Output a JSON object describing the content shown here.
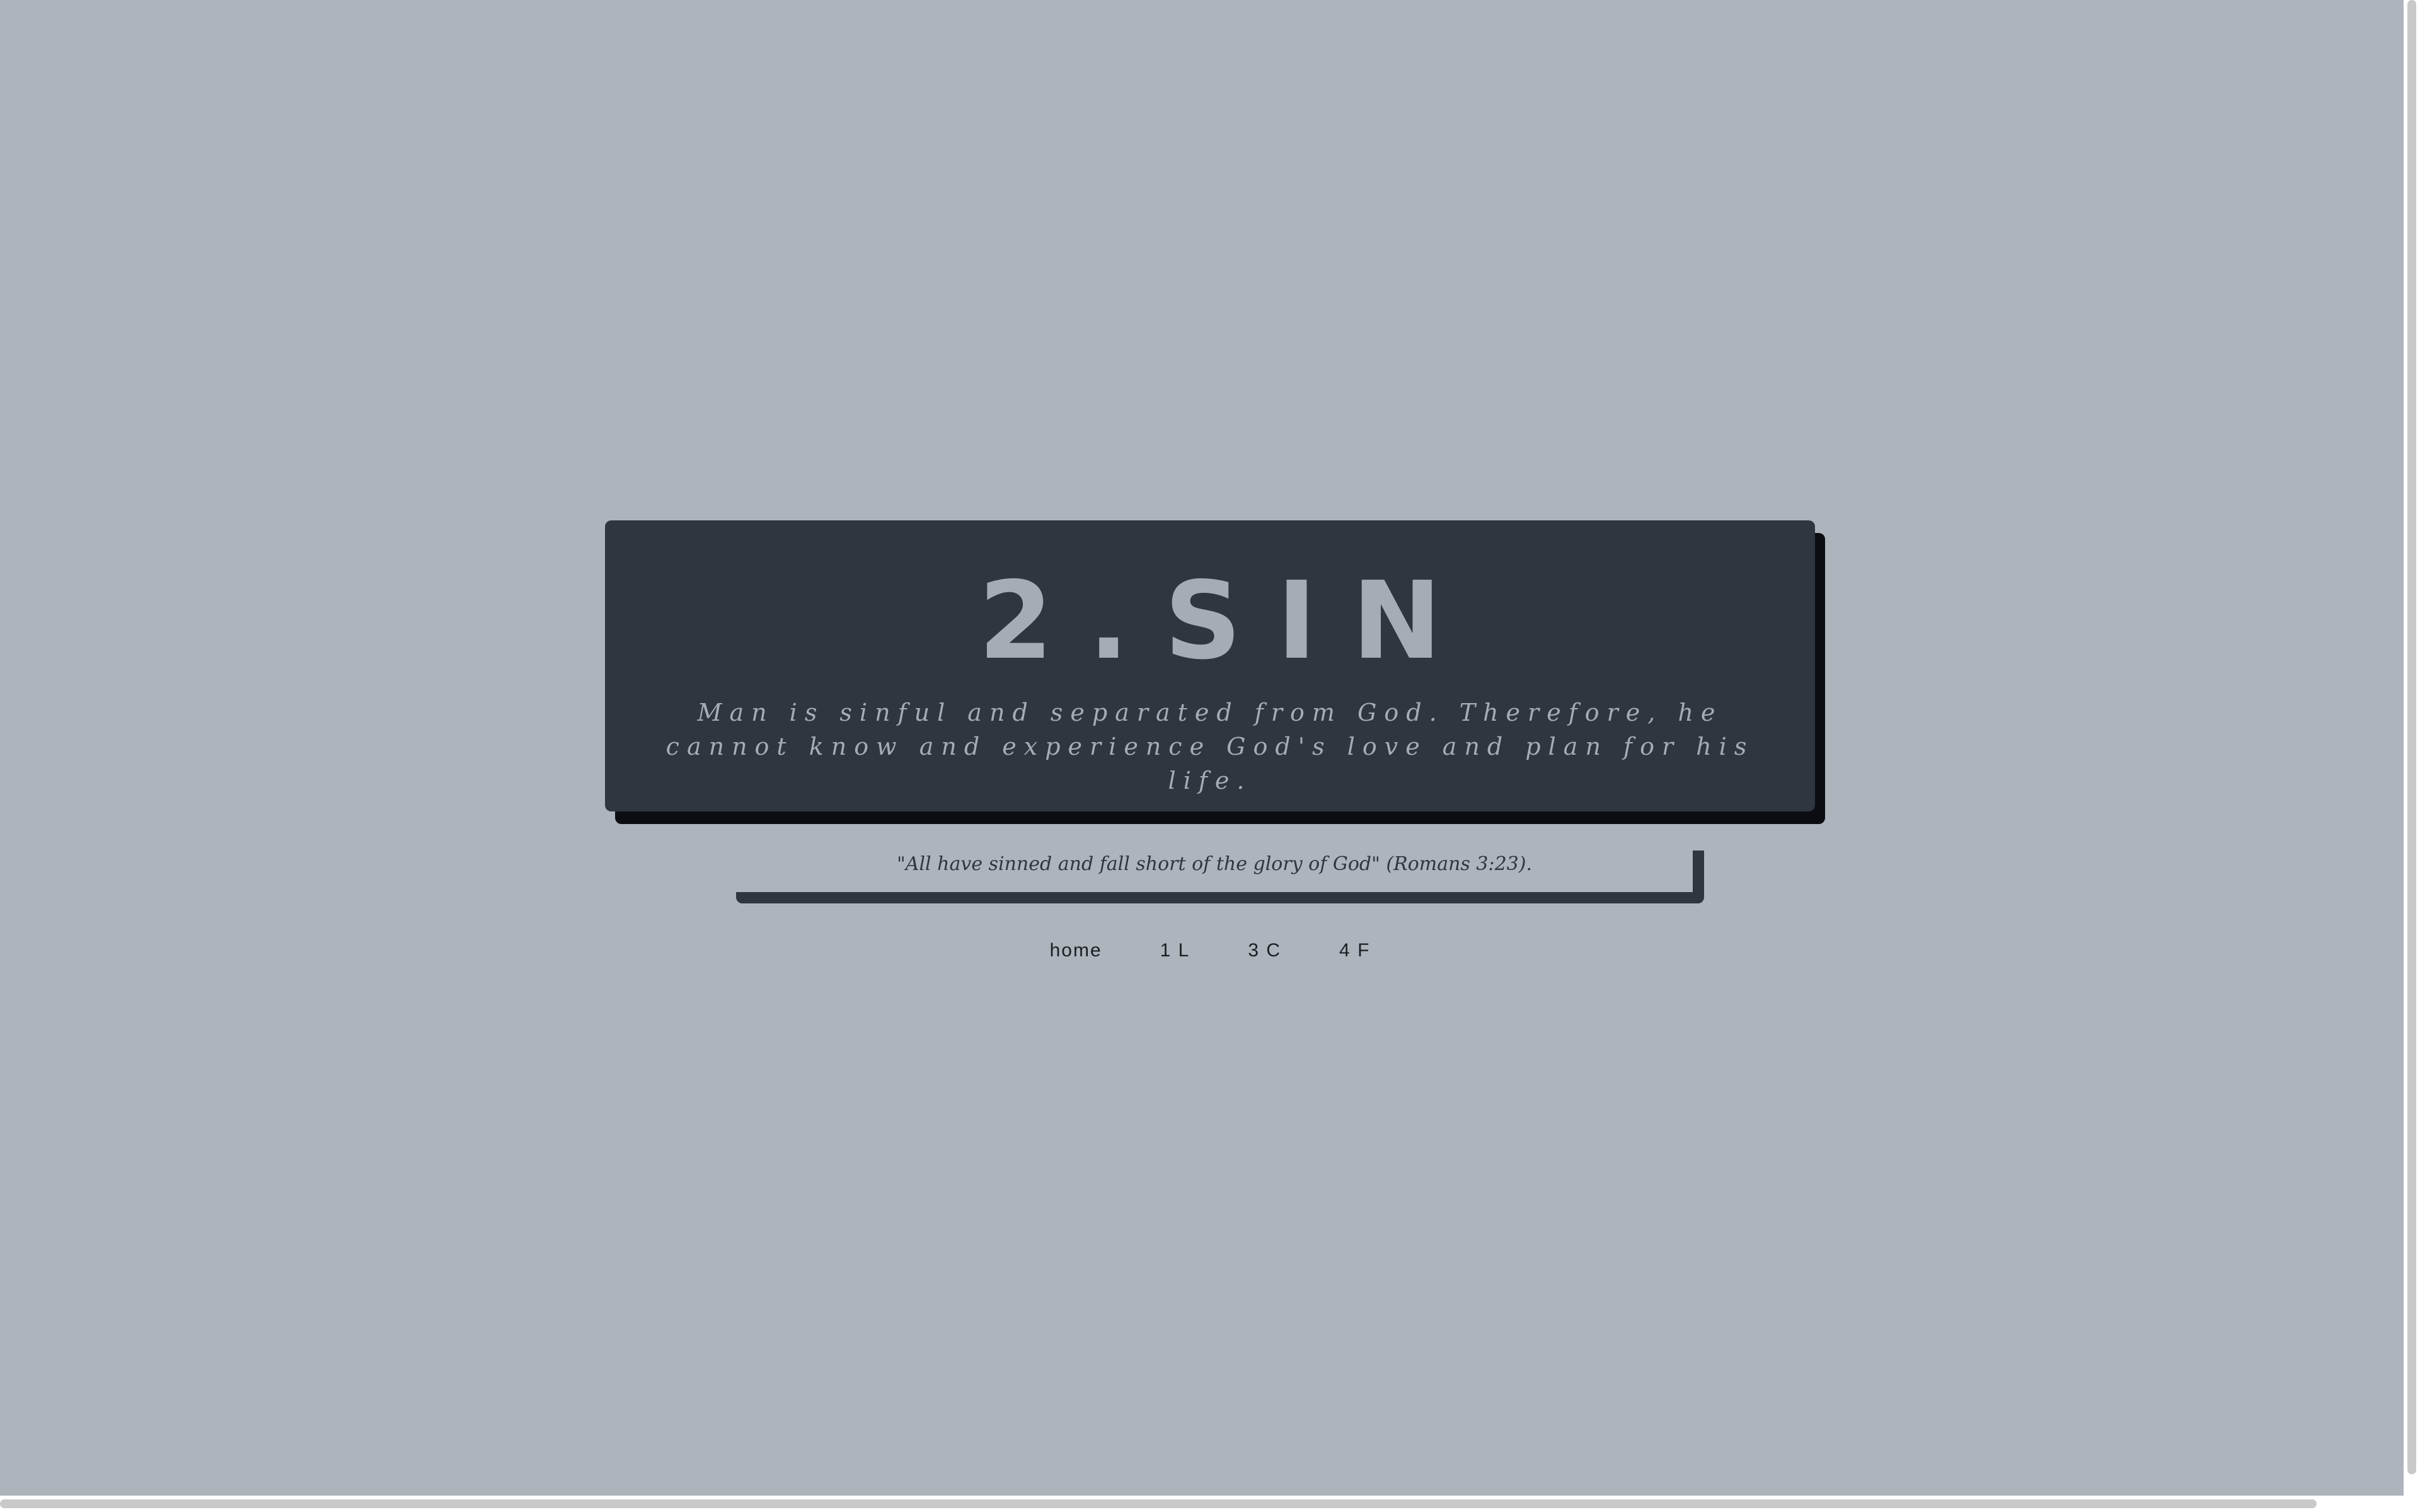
{
  "card": {
    "title": "2.SIN",
    "text": "Man is sinful and separated from God. Therefore, he cannot know and experience God's love and plan for his life."
  },
  "verse": {
    "text": "\"All have sinned and fall short of the glory of God\" (Romans 3:23)."
  },
  "nav": {
    "items": [
      {
        "label": "home"
      },
      {
        "label": "1 L"
      },
      {
        "label": "3 C"
      },
      {
        "label": "4 F"
      }
    ]
  },
  "colors": {
    "background": "#adb4bc",
    "card": "#2f3640",
    "card_text": "#a5acb5",
    "card_shadow": "#0b0d12"
  }
}
